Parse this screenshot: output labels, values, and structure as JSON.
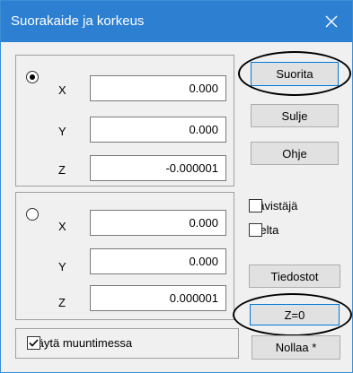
{
  "window": {
    "title": "Suorakaide ja korkeus"
  },
  "group1": {
    "selected": true,
    "fields": [
      {
        "label": "X",
        "value": "0.000"
      },
      {
        "label": "Y",
        "value": "0.000"
      },
      {
        "label": "Z",
        "value": "-0.000001"
      }
    ]
  },
  "group2": {
    "selected": false,
    "fields": [
      {
        "label": "X",
        "value": "0.000"
      },
      {
        "label": "Y",
        "value": "0.000"
      },
      {
        "label": "Z",
        "value": "0.000001"
      }
    ]
  },
  "buttons": {
    "run": "Suorita",
    "close": "Sulje",
    "help": "Ohje",
    "files": "Tiedostot",
    "z_zero": "Z=0",
    "reset": "Nollaa *"
  },
  "checkboxes": {
    "diagonal": {
      "label": "Lävistäjä",
      "checked": false
    },
    "delta": {
      "label": "Delta",
      "checked": false
    },
    "use_in_conversion": {
      "label": "Käytä muuntimessa",
      "checked": true
    }
  },
  "colors": {
    "titlebar": "#2d7fd1",
    "focus_border": "#0078d7"
  }
}
